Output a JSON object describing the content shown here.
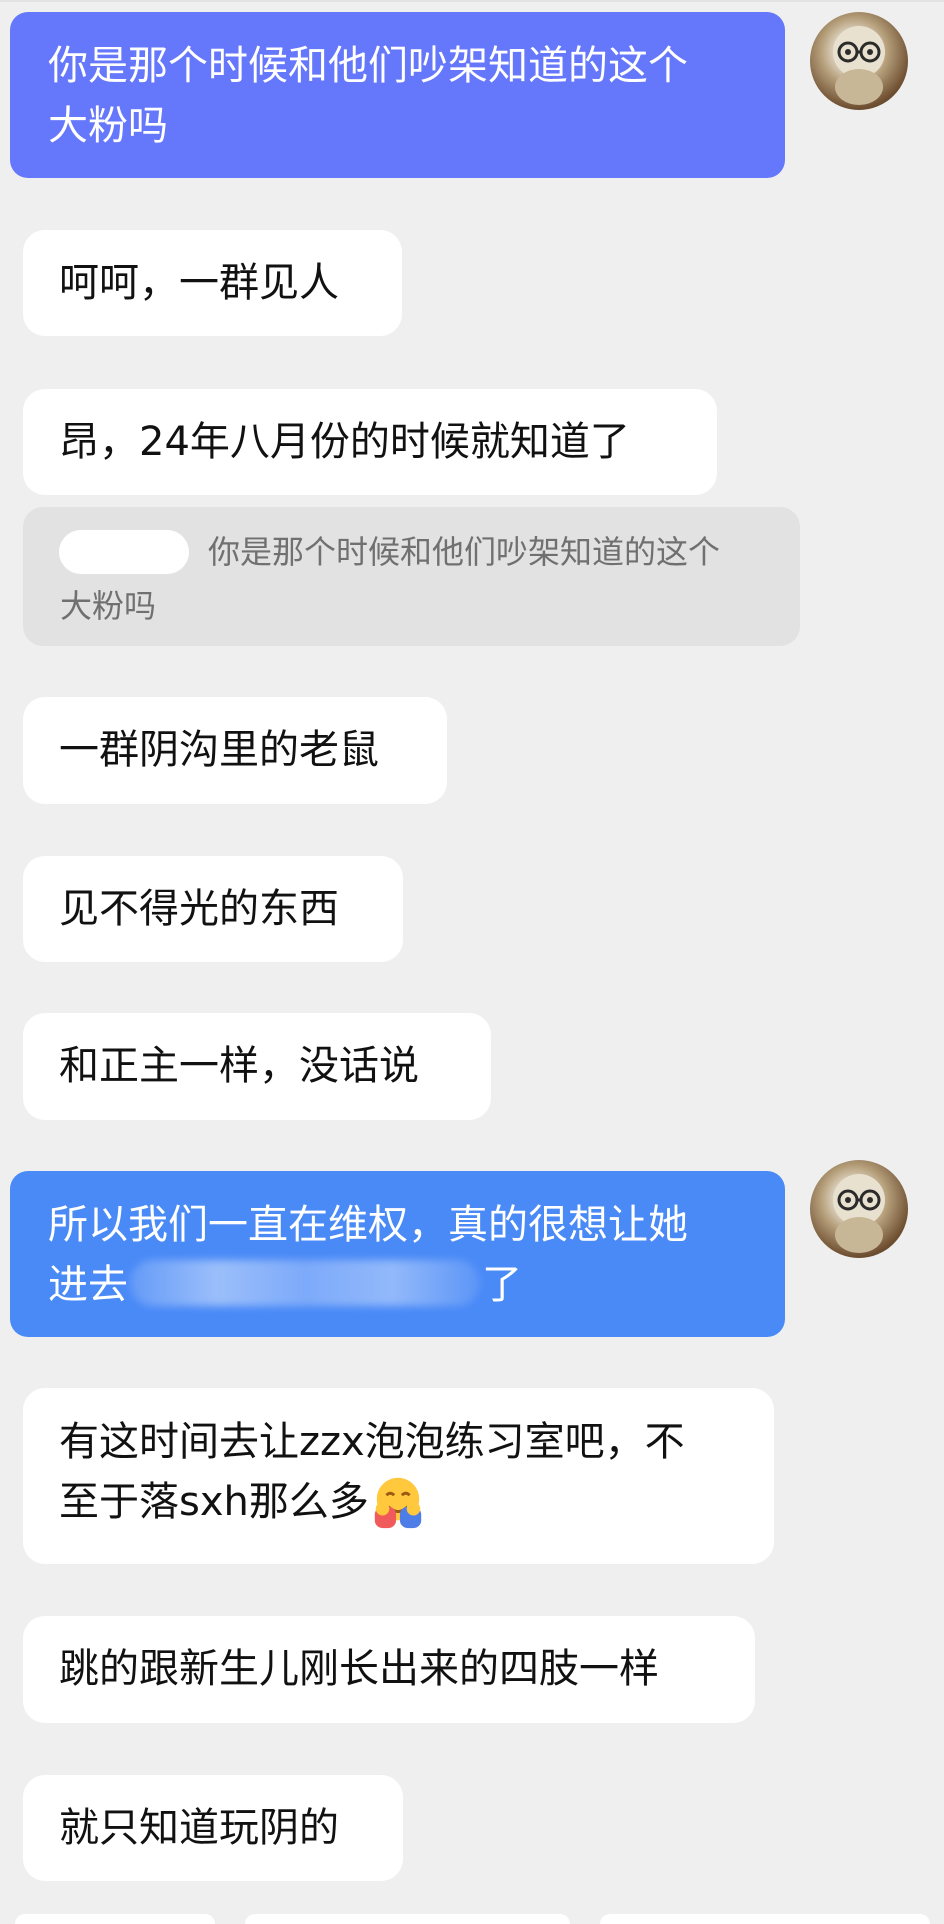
{
  "messages": [
    {
      "sender": "me",
      "text_lines": [
        "你是那个时候和他们吵架知道的这个",
        "大粉吗"
      ],
      "avatar_icon": "avatar-icon"
    },
    {
      "sender": "other",
      "text": "呵呵，一群见人"
    },
    {
      "sender": "other",
      "text": "昂，24年八月份的时候就知道了"
    },
    {
      "type": "quote",
      "quoted_line1": "你是那个时候和他们吵架知道的这个",
      "quoted_line2": "大粉吗"
    },
    {
      "sender": "other",
      "text": "一群阴沟里的老鼠"
    },
    {
      "sender": "other",
      "text": "见不得光的东西"
    },
    {
      "sender": "other",
      "text": "和正主一样，没话说"
    },
    {
      "sender": "me",
      "text_line1": "所以我们一直在维权，真的很想让她",
      "text_line2_start": "进去",
      "text_line2_end": "了",
      "avatar_icon": "avatar-icon"
    },
    {
      "sender": "other",
      "text_line1": "有这时间去让zzx泡泡练习室吧，不",
      "text_line2": "至于落sxh那么多",
      "emoji_icon": "hugging-face-icon"
    },
    {
      "sender": "other",
      "text": "跳的跟新生儿刚长出来的四肢一样"
    },
    {
      "sender": "other",
      "text": "就只知道玩阴的"
    }
  ],
  "colors": {
    "background": "#efefef",
    "outgoing_purple": "#6577fb",
    "outgoing_blue": "#4a8af7",
    "incoming": "#ffffff",
    "quote_bg": "#e2e2e2",
    "quote_text": "#707070"
  }
}
